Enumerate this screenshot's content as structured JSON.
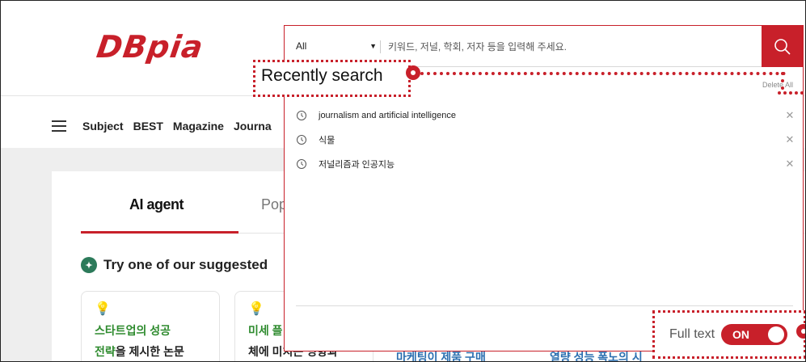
{
  "site": {
    "logo": "DBpia"
  },
  "nav": {
    "items": [
      "Subject",
      "BEST",
      "Magazine",
      "Journa"
    ]
  },
  "tabs": {
    "active": "AI agent",
    "second": "Pop"
  },
  "suggestions": {
    "title": "Try one of our suggested",
    "cards": [
      {
        "line1": "스타트업의 성공",
        "line2_highlight": "전략",
        "line2_rest": "을 제시한 논문"
      },
      {
        "line1": "미세 플",
        "line2_highlight": "",
        "line2_rest": "체에 미치는 영향과"
      }
    ],
    "behind_texts": [
      "마케팅이 제품 구매",
      "열량 성능 폭노의 시"
    ]
  },
  "search": {
    "scope": "All",
    "placeholder": "키워드, 저널, 학회, 저자 등을 입력해 주세요.",
    "recent_title": "Recently search",
    "delete_all": "Delete All",
    "recent_items": [
      "journalism and artificial intelligence",
      "식물",
      "저널리즘과 인공지능"
    ],
    "fulltext_label": "Full text",
    "fulltext_state": "ON"
  },
  "colors": {
    "brand": "#c8202a",
    "highlight_text": "#2e8b2e"
  },
  "icons": {
    "search": "search-icon",
    "clock": "clock-icon",
    "remove": "close-icon",
    "menu": "hamburger-icon",
    "bulb": "lightbulb-icon",
    "sparkle": "sparkle-icon"
  }
}
